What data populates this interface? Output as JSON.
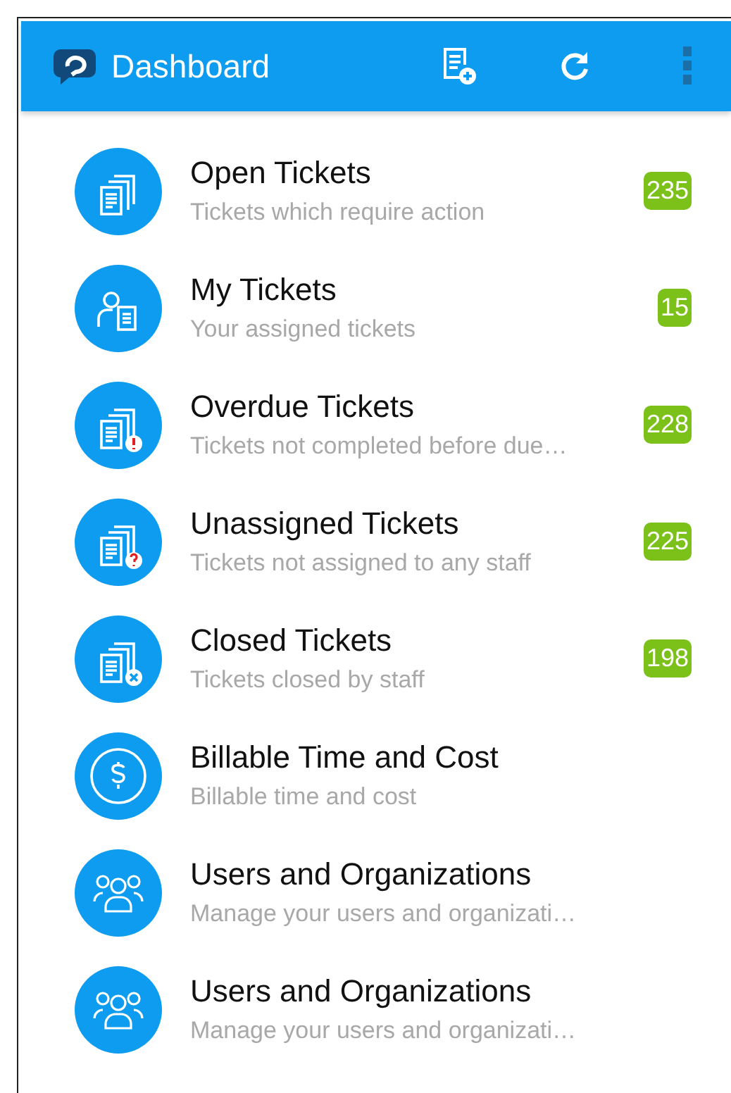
{
  "app_bar": {
    "title": "Dashboard"
  },
  "items": [
    {
      "kind": "tickets",
      "title": "Open Tickets",
      "subtitle": "Tickets which require action",
      "count": "235"
    },
    {
      "kind": "mine",
      "title": "My Tickets",
      "subtitle": "Your assigned tickets",
      "count": "15"
    },
    {
      "kind": "overdue",
      "title": "Overdue Tickets",
      "subtitle": "Tickets not completed before due…",
      "count": "228"
    },
    {
      "kind": "unassigned",
      "title": "Unassigned Tickets",
      "subtitle": "Tickets not assigned to any staff",
      "count": "225"
    },
    {
      "kind": "closed",
      "title": "Closed Tickets",
      "subtitle": "Tickets closed by staff",
      "count": "198"
    },
    {
      "kind": "billing",
      "title": "Billable Time and Cost",
      "subtitle": "Billable time and cost"
    },
    {
      "kind": "users",
      "title": "Users and Organizations",
      "subtitle": "Manage your users and organizati…"
    },
    {
      "kind": "users",
      "title": "Users and Organizations",
      "subtitle": "Manage your users and organizati…"
    }
  ]
}
